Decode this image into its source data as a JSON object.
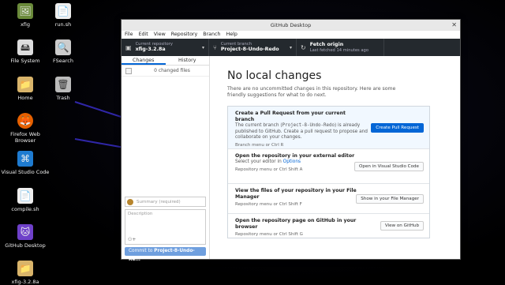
{
  "desktop": {
    "icons": [
      {
        "label": "xfig",
        "glyph": "🖼"
      },
      {
        "label": "run.sh",
        "glyph": "📄"
      },
      {
        "label": "File System",
        "glyph": "🖴"
      },
      {
        "label": "FSearch",
        "glyph": "🔍"
      },
      {
        "label": "Home",
        "glyph": "📁"
      },
      {
        "label": "Trash",
        "glyph": "🗑"
      },
      {
        "label": "Firefox Web Browser",
        "glyph": "🦊"
      },
      {
        "label": "Visual Studio Code",
        "glyph": "⌘"
      },
      {
        "label": "compile.sh",
        "glyph": "📄"
      },
      {
        "label": "GitHub Desktop",
        "glyph": "🐱"
      },
      {
        "label": "xfig-3.2.8a",
        "glyph": "📁"
      }
    ]
  },
  "window": {
    "title": "GitHub Desktop",
    "menu": [
      "File",
      "Edit",
      "View",
      "Repository",
      "Branch",
      "Help"
    ]
  },
  "toolbar": {
    "repo_label": "Current repository",
    "repo_value": "xfig-3.2.8a",
    "branch_label": "Current branch",
    "branch_value": "Project-8-Undo-Redo",
    "fetch_label": "Fetch origin",
    "fetch_sub": "Last fetched 14 minutes ago"
  },
  "sidebar": {
    "tab_changes": "Changes",
    "tab_history": "History",
    "changed_files": "0 changed files",
    "summary_placeholder": "Summary (required)",
    "description_placeholder": "Description",
    "commit_prefix": "Commit to ",
    "commit_branch": "Project-8-Undo-Re..."
  },
  "main": {
    "title": "No local changes",
    "subtitle": "There are no uncommitted changes in this repository. Here are some friendly suggestions for what to do next.",
    "pr": {
      "title": "Create a Pull Request from your current branch",
      "desc_a": "The current branch (",
      "desc_branch": "Project-8-Undo-Redo",
      "desc_b": ") is already published to GitHub. Create a pull request to propose and collaborate on your changes.",
      "shortcut": "Branch menu or  Ctrl  R",
      "button": "Create Pull Request"
    },
    "editor": {
      "title": "Open the repository in your external editor",
      "desc_a": "Select your editor in ",
      "desc_link": "Options",
      "shortcut": "Repository menu or  Ctrl  Shift  A",
      "button": "Open in Visual Studio Code"
    },
    "files": {
      "title": "View the files of your repository in your File Manager",
      "shortcut": "Repository menu or  Ctrl  Shift  F",
      "button": "Show in your File Manager"
    },
    "github": {
      "title": "Open the repository page on GitHub in your browser",
      "shortcut": "Repository menu or  Ctrl  Shift  G",
      "button": "View on GitHub"
    }
  }
}
